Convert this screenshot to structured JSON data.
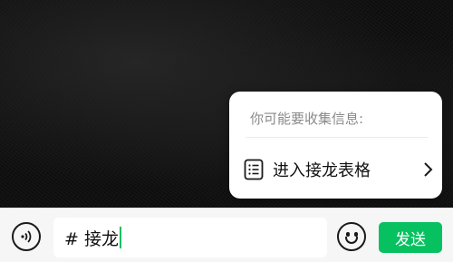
{
  "popup": {
    "hint": "你可能要收集信息:",
    "action_label": "进入接龙表格",
    "action_icon": "list-icon",
    "chevron_icon": "chevron-right-icon"
  },
  "input_bar": {
    "voice_icon": "voice-icon",
    "text_value": "# 接龙",
    "emoji_icon": "emoji-icon",
    "send_label": "发送"
  },
  "colors": {
    "accent": "#07c160",
    "background": "#0f0f0f",
    "bar": "#f6f6f6"
  }
}
